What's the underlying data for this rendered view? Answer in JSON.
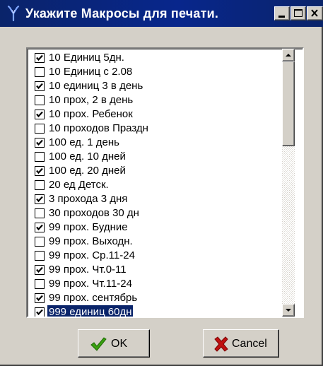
{
  "window": {
    "title": "Укажите Макросы для печати."
  },
  "list": {
    "items": [
      {
        "label": "10 Единиц 5дн.",
        "checked": true
      },
      {
        "label": "10 Единиц с 2.08",
        "checked": false
      },
      {
        "label": "10 единиц 3 в день",
        "checked": true
      },
      {
        "label": "10 прох, 2 в день",
        "checked": false
      },
      {
        "label": "10 прох. Ребенок",
        "checked": true
      },
      {
        "label": "10 проходов Праздн",
        "checked": false
      },
      {
        "label": "100 ед. 1 день",
        "checked": true
      },
      {
        "label": "100 ед. 10 дней",
        "checked": false
      },
      {
        "label": "100 ед. 20 дней",
        "checked": true
      },
      {
        "label": "20 ед Детск.",
        "checked": false
      },
      {
        "label": "3 прохода 3 дня",
        "checked": true
      },
      {
        "label": "30 проходов 30 дн",
        "checked": false
      },
      {
        "label": "99 прох. Будние",
        "checked": true
      },
      {
        "label": "99 прох. Выходн.",
        "checked": false
      },
      {
        "label": "99 прох. Ср.11-24",
        "checked": false
      },
      {
        "label": "99 прох. Чт.0-11",
        "checked": true
      },
      {
        "label": "99 прох. Чт.11-24",
        "checked": false
      },
      {
        "label": "99 прох. сентябрь",
        "checked": true
      },
      {
        "label": "999 единиц 60дн",
        "checked": true,
        "selected": true
      }
    ],
    "scroll_position": 0.0
  },
  "buttons": {
    "ok_label": "OK",
    "cancel_label": "Cancel"
  },
  "icons": {
    "app": "tuning-fork-icon",
    "ok": "checkmark-icon",
    "cancel": "x-mark-icon"
  },
  "colors": {
    "titlebar": "#0a246a",
    "face": "#d4d0c8",
    "selection": "#0a246a",
    "ok_icon": "#3aa010",
    "cancel_icon": "#c01010"
  }
}
